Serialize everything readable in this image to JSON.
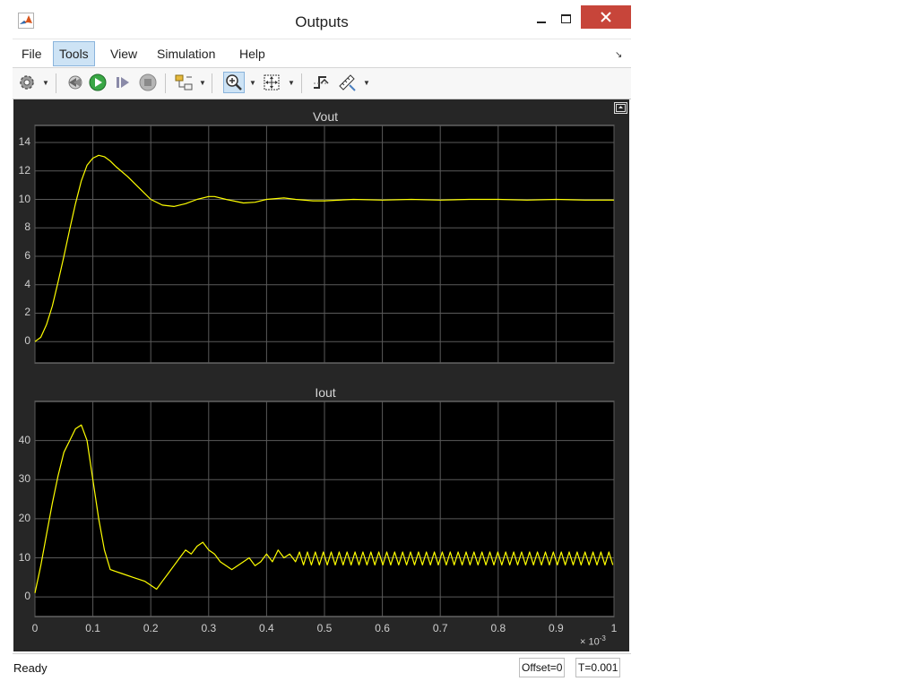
{
  "window": {
    "title": "Outputs"
  },
  "menu": {
    "items": [
      "File",
      "Tools",
      "View",
      "Simulation",
      "Help"
    ]
  },
  "toolbar": {
    "buttons": [
      "settings-icon",
      "step-back-icon",
      "run-icon",
      "step-forward-icon",
      "stop-icon",
      "signal-select-icon",
      "zoom-in-icon",
      "fit-to-view-icon",
      "triggers-icon",
      "measurements-icon"
    ]
  },
  "status": {
    "text": "Ready",
    "offset": "Offset=0",
    "time": "T=0.001"
  },
  "colors": {
    "trace": "#ffff00",
    "axes_bg": "#000000",
    "panel_bg": "#262626",
    "grid": "#5a5a5a",
    "close": "#c7453a"
  },
  "chart_data": [
    {
      "type": "line",
      "title": "Vout",
      "xlim": [
        0,
        1
      ],
      "ylim": [
        -1.5,
        15.2
      ],
      "xticks": [
        "0",
        "0.1",
        "0.2",
        "0.3",
        "0.4",
        "0.5",
        "0.6",
        "0.7",
        "0.8",
        "0.9",
        "1"
      ],
      "yticks": [
        "0",
        "2",
        "4",
        "6",
        "8",
        "10",
        "12",
        "14"
      ],
      "x_exponent_label": "× 10",
      "x_exponent": "-3",
      "grid": true,
      "x": [
        0,
        0.01,
        0.02,
        0.03,
        0.04,
        0.05,
        0.06,
        0.07,
        0.08,
        0.09,
        0.1,
        0.11,
        0.12,
        0.13,
        0.14,
        0.16,
        0.18,
        0.2,
        0.22,
        0.24,
        0.26,
        0.28,
        0.3,
        0.31,
        0.33,
        0.36,
        0.38,
        0.4,
        0.43,
        0.45,
        0.48,
        0.5,
        0.55,
        0.6,
        0.65,
        0.7,
        0.75,
        0.8,
        0.85,
        0.9,
        0.95,
        1.0
      ],
      "y": [
        0,
        0.3,
        1.2,
        2.5,
        4.2,
        6.0,
        7.9,
        9.7,
        11.3,
        12.4,
        12.9,
        13.1,
        13.0,
        12.7,
        12.3,
        11.6,
        10.8,
        10.0,
        9.6,
        9.5,
        9.7,
        10.0,
        10.2,
        10.2,
        10.0,
        9.75,
        9.8,
        10.0,
        10.1,
        10.0,
        9.9,
        9.9,
        10.0,
        9.95,
        10.0,
        9.95,
        10.0,
        10.0,
        9.95,
        10.0,
        9.95,
        9.95
      ]
    },
    {
      "type": "line",
      "title": "Iout",
      "xlim": [
        0,
        1
      ],
      "ylim": [
        -5,
        50
      ],
      "xticks": [
        "0",
        "0.1",
        "0.2",
        "0.3",
        "0.4",
        "0.5",
        "0.6",
        "0.7",
        "0.8",
        "0.9",
        "1"
      ],
      "yticks": [
        "0",
        "10",
        "20",
        "30",
        "40"
      ],
      "grid": true,
      "x": [
        0,
        0.01,
        0.02,
        0.03,
        0.04,
        0.05,
        0.06,
        0.07,
        0.08,
        0.09,
        0.1,
        0.11,
        0.12,
        0.13,
        0.15,
        0.17,
        0.19,
        0.2,
        0.21,
        0.22,
        0.23,
        0.24,
        0.25,
        0.26,
        0.27,
        0.28,
        0.29,
        0.3,
        0.31,
        0.32,
        0.33,
        0.34,
        0.35,
        0.36,
        0.37,
        0.38,
        0.39,
        0.4,
        0.41,
        0.42,
        0.43,
        0.44,
        0.45
      ],
      "y": [
        1,
        8,
        16,
        24,
        31,
        37,
        40,
        43,
        44,
        40,
        30,
        20,
        12,
        7,
        6,
        5,
        4,
        3,
        2,
        4,
        6,
        8,
        10,
        12,
        11,
        13,
        14,
        12,
        11,
        9,
        8,
        7,
        8,
        9,
        10,
        8,
        9,
        11,
        9,
        12,
        10,
        11,
        9
      ],
      "ripple": {
        "from": 0.45,
        "to": 1.0,
        "period": 0.0137,
        "low": 8.2,
        "high": 11.5
      }
    }
  ]
}
